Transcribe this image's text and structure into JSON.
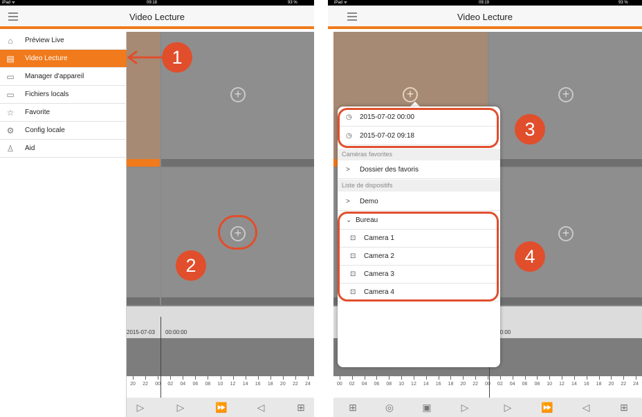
{
  "colors": {
    "accent": "#f07a1c",
    "marker": "#e14e2c"
  },
  "left_screen": {
    "status": {
      "device": "iPad ᯤ",
      "time": "09:18",
      "battery": "93 %"
    },
    "title": "Video Lecture",
    "sidebar": {
      "items": [
        {
          "label": "Préview Live",
          "icon": "camera-icon"
        },
        {
          "label": "Video Lecture",
          "icon": "film-icon",
          "active": true
        },
        {
          "label": "Manager d'appareil",
          "icon": "device-icon"
        },
        {
          "label": "Fichiers locals",
          "icon": "folder-icon"
        },
        {
          "label": "Favorite",
          "icon": "star-icon"
        },
        {
          "label": "Config locale",
          "icon": "gear-icon"
        },
        {
          "label": "Aid",
          "icon": "user-icon"
        }
      ]
    },
    "timeline": {
      "date": "2015-07-03",
      "time": "00:00:00"
    },
    "ruler_ticks": [
      "20",
      "22",
      "00",
      "02",
      "04",
      "06",
      "08",
      "10",
      "12",
      "14",
      "16",
      "18",
      "20",
      "22",
      "24"
    ],
    "markers": {
      "m1": "1",
      "m2": "2"
    }
  },
  "right_screen": {
    "status": {
      "device": "iPad ᯤ",
      "time": "09:19",
      "battery": "93 %"
    },
    "title": "Video Lecture",
    "start_time": "2015-07-02 00:00",
    "end_time": "2015-07-02 09:18",
    "favorites_header": "Caméras favorites",
    "favorites_folder": "Dossier des favoris",
    "devices_header": "Liste de dispositifs",
    "devices": [
      {
        "label": "Demo",
        "expanded": false
      },
      {
        "label": "Bureau",
        "expanded": true
      }
    ],
    "cameras": [
      "Camera 1",
      "Camera 2",
      "Camera 3",
      "Camera 4"
    ],
    "timeline_time": ":00:00",
    "ruler_ticks": [
      "00",
      "02",
      "04",
      "06",
      "08",
      "10",
      "12",
      "14",
      "16",
      "18",
      "20",
      "22",
      "00",
      "02",
      "04",
      "06",
      "08",
      "10",
      "12",
      "14",
      "16",
      "18",
      "20",
      "22",
      "24"
    ],
    "markers": {
      "m3": "3",
      "m4": "4"
    }
  }
}
